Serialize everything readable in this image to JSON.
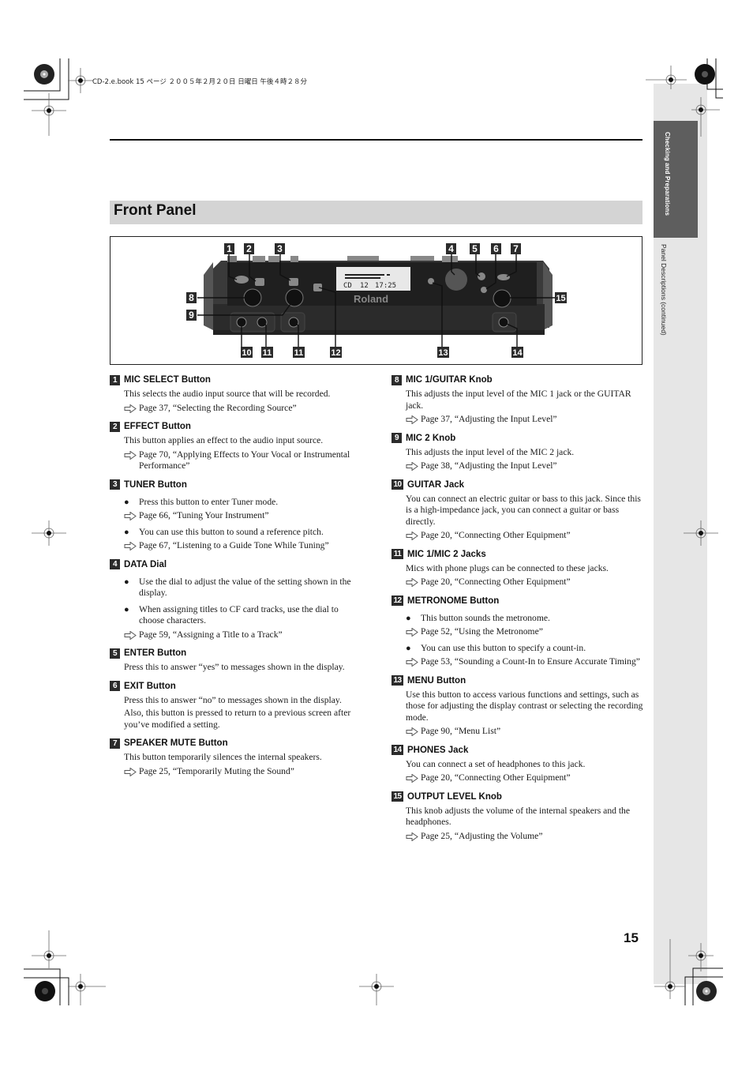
{
  "print_header": "CD-2.e.book  15 ページ  ２００５年２月２０日  日曜日  午後４時２８分",
  "side_tab": {
    "chapter": "Checking and Preparations",
    "section": "Panel Descriptions (continued)"
  },
  "section_title": "Front Panel",
  "figure": {
    "device_brand": "Roland",
    "display_readout": {
      "mode": "CD",
      "track": "12",
      "time": "17:25"
    },
    "callouts": [
      "1",
      "2",
      "3",
      "4",
      "5",
      "6",
      "7",
      "8",
      "9",
      "10",
      "11",
      "11",
      "12",
      "13",
      "14",
      "15"
    ]
  },
  "items_left": [
    {
      "num": "1",
      "title": "MIC SELECT Button",
      "blocks": [
        {
          "type": "para",
          "text": "This selects the audio input source that will be recorded."
        },
        {
          "type": "ref",
          "text": "Page 37, “Selecting the Recording Source”"
        }
      ]
    },
    {
      "num": "2",
      "title": "EFFECT Button",
      "blocks": [
        {
          "type": "para",
          "text": "This button applies an effect to the audio input source."
        },
        {
          "type": "ref",
          "text": "Page 70, “Applying Effects to Your Vocal or Instrumental Performance”"
        }
      ]
    },
    {
      "num": "3",
      "title": "TUNER Button",
      "blocks": [
        {
          "type": "bullet",
          "text": "Press this button to enter Tuner mode."
        },
        {
          "type": "ref",
          "text": "Page 66, “Tuning Your Instrument”"
        },
        {
          "type": "bullet",
          "text": "You can use this button to sound a reference pitch."
        },
        {
          "type": "ref",
          "text": "Page 67, “Listening to a Guide Tone While Tuning”"
        }
      ]
    },
    {
      "num": "4",
      "title": "DATA Dial",
      "blocks": [
        {
          "type": "bullet",
          "text": "Use the dial to adjust the value of the setting shown in the display."
        },
        {
          "type": "bullet",
          "text": "When assigning titles to CF card tracks, use the dial to choose characters."
        },
        {
          "type": "ref",
          "text": "Page 59, “Assigning a Title to a Track”"
        }
      ]
    },
    {
      "num": "5",
      "title": "ENTER Button",
      "blocks": [
        {
          "type": "para",
          "text": "Press this to answer “yes” to messages shown in the display."
        }
      ]
    },
    {
      "num": "6",
      "title": "EXIT Button",
      "blocks": [
        {
          "type": "para",
          "text": "Press this to answer “no” to messages shown in the display."
        },
        {
          "type": "para",
          "text": "Also, this button is pressed to return to a previous screen after you’ve modified a setting."
        }
      ]
    },
    {
      "num": "7",
      "title": "SPEAKER MUTE Button",
      "blocks": [
        {
          "type": "para",
          "text": "This button temporarily silences the internal speakers."
        },
        {
          "type": "ref",
          "text": "Page 25, “Temporarily Muting the Sound”"
        }
      ]
    }
  ],
  "items_right": [
    {
      "num": "8",
      "title": "MIC 1/GUITAR Knob",
      "blocks": [
        {
          "type": "para",
          "text": "This adjusts the input level of the MIC 1 jack or the GUITAR jack."
        },
        {
          "type": "ref",
          "text": "Page 37, “Adjusting the Input Level”"
        }
      ]
    },
    {
      "num": "9",
      "title": "MIC 2 Knob",
      "blocks": [
        {
          "type": "para",
          "text": "This adjusts the input level of the MIC 2 jack."
        },
        {
          "type": "ref",
          "text": "Page 38, “Adjusting the Input Level”"
        }
      ]
    },
    {
      "num": "10",
      "title": "GUITAR Jack",
      "blocks": [
        {
          "type": "para",
          "text": "You can connect an electric guitar or bass to this jack. Since this is a high-impedance jack, you can connect a guitar or bass directly."
        },
        {
          "type": "ref",
          "text": "Page 20, “Connecting Other Equipment”"
        }
      ]
    },
    {
      "num": "11",
      "title": "MIC 1/MIC 2 Jacks",
      "blocks": [
        {
          "type": "para",
          "text": "Mics with phone plugs can be connected to these jacks."
        },
        {
          "type": "ref",
          "text": "Page 20, “Connecting Other Equipment”"
        }
      ]
    },
    {
      "num": "12",
      "title": "METRONOME Button",
      "blocks": [
        {
          "type": "bullet",
          "text": "This button sounds the metronome."
        },
        {
          "type": "ref",
          "text": "Page 52, “Using the Metronome”"
        },
        {
          "type": "bullet",
          "text": "You can use this button to specify a count-in."
        },
        {
          "type": "ref",
          "text": "Page 53, “Sounding a Count-In to Ensure Accurate Timing”"
        }
      ]
    },
    {
      "num": "13",
      "title": "MENU Button",
      "blocks": [
        {
          "type": "para",
          "text": "Use this button to access various functions and settings, such as those for adjusting the display contrast or selecting the recording mode."
        },
        {
          "type": "ref",
          "text": "Page 90, “Menu List”"
        }
      ]
    },
    {
      "num": "14",
      "title": "PHONES Jack",
      "blocks": [
        {
          "type": "para",
          "text": "You can connect a set of headphones to this jack."
        },
        {
          "type": "ref",
          "text": "Page 20, “Connecting Other Equipment”"
        }
      ]
    },
    {
      "num": "15",
      "title": "OUTPUT LEVEL Knob",
      "blocks": [
        {
          "type": "para",
          "text": "This knob adjusts the volume of the internal speakers and the headphones."
        },
        {
          "type": "ref",
          "text": "Page 25, “Adjusting the Volume”"
        }
      ]
    }
  ],
  "page_number": "15"
}
